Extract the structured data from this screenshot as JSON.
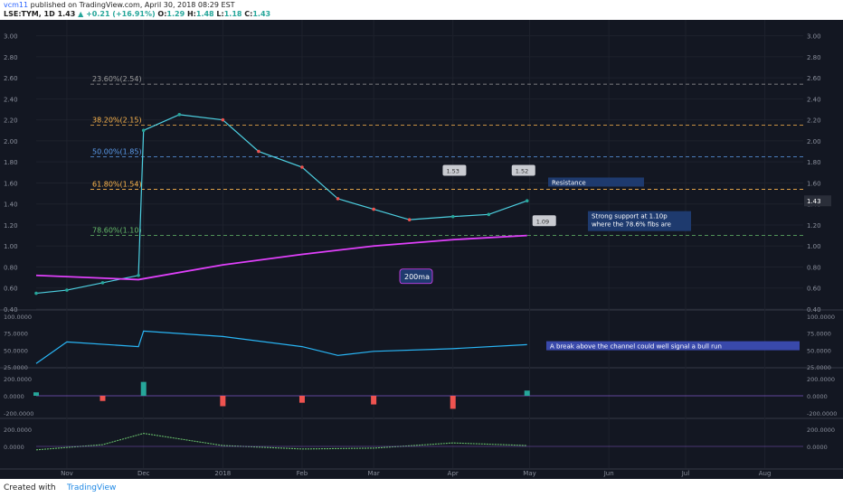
{
  "header": {
    "publisher": "vcm11",
    "published_text": "published on TradingView.com, April 30, 2018 08:29 EST",
    "symbol": "LSE:TYM, 1D",
    "last": "1.43",
    "change": "+0.21 (+16.91%)",
    "o_label": "O:",
    "o_value": "1.29",
    "h_label": "H:",
    "h_value": "1.48",
    "l_label": "L:",
    "l_value": "1.18",
    "c_label": "C:",
    "c_value": "1.43"
  },
  "footer": {
    "created": "Created with",
    "brand": "TradingView"
  },
  "colors": {
    "background": "#131722",
    "up": "#26a69a",
    "down": "#ef5350",
    "ma200": "#e040fb",
    "annotation_box": "#1e3a6e"
  },
  "chart_data": [
    {
      "type": "line",
      "panel": "price",
      "ylim": [
        0.4,
        3.1
      ],
      "y_ticks": [
        "3.00",
        "2.80",
        "2.60",
        "2.40",
        "2.20",
        "2.00",
        "1.80",
        "1.60",
        "1.40",
        "1.20",
        "1.00",
        "0.80",
        "0.60",
        "0.40"
      ],
      "x_ticks": [
        "Nov",
        "Dec",
        "2018",
        "Feb",
        "Mar",
        "Apr",
        "May",
        "Jun",
        "Jul",
        "Aug"
      ],
      "last_price_label": "1.43",
      "series": [
        {
          "name": "",
          "x": [
            "Oct 20",
            "Nov 1",
            "Nov 15",
            "Nov 29",
            "Dec 1",
            "Dec 15",
            "Jan 1",
            "Jan 15",
            "Feb 1",
            "Feb 15",
            "Mar 1",
            "Mar 15",
            "Apr 1",
            "Apr 15",
            "Apr 30"
          ],
          "values": [
            0.55,
            0.58,
            0.65,
            0.72,
            2.1,
            2.25,
            2.2,
            1.9,
            1.75,
            1.45,
            1.35,
            1.25,
            1.28,
            1.3,
            1.43
          ]
        },
        {
          "name": "200ma",
          "x": [
            "Oct 20",
            "Nov 29",
            "Jan 1",
            "Feb 1",
            "Mar 1",
            "Apr 1",
            "Apr 30"
          ],
          "values": [
            0.72,
            0.68,
            0.82,
            0.92,
            1.0,
            1.06,
            1.1
          ]
        }
      ],
      "fib_levels": [
        {
          "label": "23.60%(2.54)",
          "value": 2.54,
          "color": "#9e9e9e"
        },
        {
          "label": "38.20%(2.15)",
          "value": 2.15,
          "color": "#ffb74d"
        },
        {
          "label": "50.00%(1.85)",
          "value": 1.85,
          "color": "#5c9ded"
        },
        {
          "label": "61.80%(1.54)",
          "value": 1.54,
          "color": "#ffb74d"
        },
        {
          "label": "78.60%(1.10)",
          "value": 1.1,
          "color": "#66bb6a"
        }
      ],
      "callouts": [
        "1.53",
        "1.52",
        "1.09"
      ],
      "annotations": {
        "resistance": "Resistance",
        "support": "Strong support at 1.10p\nwhere the 78.6% fibs are",
        "ma_label": "200ma"
      }
    },
    {
      "type": "line",
      "panel": "oscillator_1",
      "ylim": [
        25,
        100
      ],
      "y_ticks": [
        "100.0000",
        "75.0000",
        "50.0000",
        "25.0000"
      ],
      "annotation": "A break above the channel could well signal a bull run",
      "series": [
        {
          "name": "",
          "x": [
            "Oct 20",
            "Nov 1",
            "Nov 29",
            "Dec 1",
            "Jan 1",
            "Feb 1",
            "Feb 15",
            "Mar 1",
            "Apr 1",
            "Apr 30"
          ],
          "values": [
            30,
            62,
            55,
            78,
            70,
            55,
            42,
            48,
            52,
            58
          ]
        }
      ]
    },
    {
      "type": "bar",
      "panel": "oscillator_2",
      "ylim": [
        -250,
        250
      ],
      "y_ticks": [
        "200.0000",
        "0.0000",
        "-200.0000"
      ],
      "series": [
        {
          "name": "",
          "x": [
            "Oct 20",
            "Nov 15",
            "Dec 1",
            "Jan 1",
            "Feb 1",
            "Mar 1",
            "Apr 1",
            "Apr 30"
          ],
          "values": [
            40,
            -60,
            160,
            -120,
            -80,
            -100,
            -150,
            60
          ]
        }
      ]
    },
    {
      "type": "line",
      "panel": "oscillator_3",
      "ylim": [
        -250,
        250
      ],
      "y_ticks": [
        "200.0000",
        "0.0000"
      ],
      "series": [
        {
          "name": "",
          "x": [
            "Oct 20",
            "Nov 15",
            "Dec 1",
            "Jan 1",
            "Feb 1",
            "Mar 1",
            "Apr 1",
            "Apr 30"
          ],
          "values": [
            -40,
            20,
            150,
            10,
            -30,
            -20,
            40,
            10
          ]
        }
      ]
    }
  ]
}
